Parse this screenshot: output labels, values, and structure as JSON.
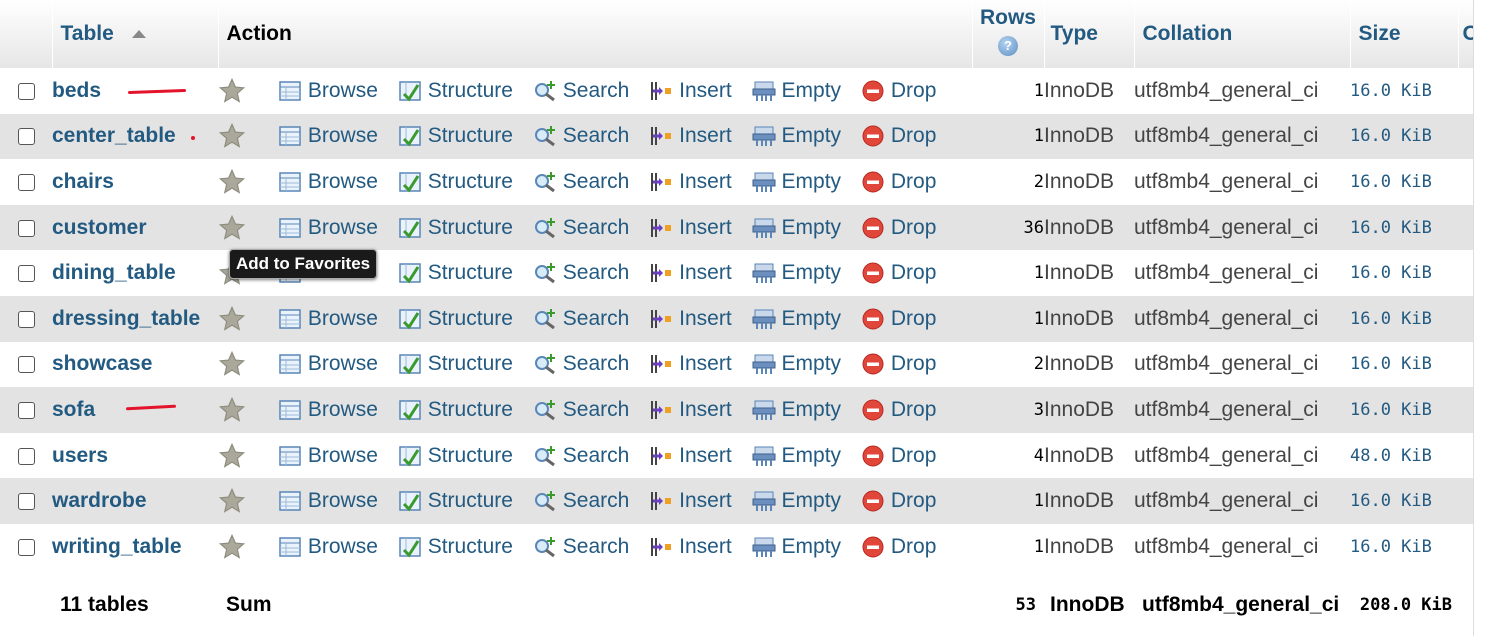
{
  "header": {
    "table": "Table",
    "action": "Action",
    "rows": "Rows",
    "type": "Type",
    "collation": "Collation",
    "size": "Size",
    "extra": "O"
  },
  "actions": {
    "browse": "Browse",
    "structure": "Structure",
    "search": "Search",
    "insert": "Insert",
    "empty": "Empty",
    "drop": "Drop"
  },
  "tables": [
    {
      "name": "beds",
      "rows": "1",
      "type": "InnoDB",
      "collation": "utf8mb4_general_ci",
      "size": "16.0 KiB"
    },
    {
      "name": "center_table",
      "rows": "1",
      "type": "InnoDB",
      "collation": "utf8mb4_general_ci",
      "size": "16.0 KiB"
    },
    {
      "name": "chairs",
      "rows": "2",
      "type": "InnoDB",
      "collation": "utf8mb4_general_ci",
      "size": "16.0 KiB"
    },
    {
      "name": "customer",
      "rows": "36",
      "type": "InnoDB",
      "collation": "utf8mb4_general_ci",
      "size": "16.0 KiB"
    },
    {
      "name": "dining_table",
      "rows": "1",
      "type": "InnoDB",
      "collation": "utf8mb4_general_ci",
      "size": "16.0 KiB"
    },
    {
      "name": "dressing_table",
      "rows": "1",
      "type": "InnoDB",
      "collation": "utf8mb4_general_ci",
      "size": "16.0 KiB"
    },
    {
      "name": "showcase",
      "rows": "2",
      "type": "InnoDB",
      "collation": "utf8mb4_general_ci",
      "size": "16.0 KiB"
    },
    {
      "name": "sofa",
      "rows": "3",
      "type": "InnoDB",
      "collation": "utf8mb4_general_ci",
      "size": "16.0 KiB"
    },
    {
      "name": "users",
      "rows": "4",
      "type": "InnoDB",
      "collation": "utf8mb4_general_ci",
      "size": "48.0 KiB"
    },
    {
      "name": "wardrobe",
      "rows": "1",
      "type": "InnoDB",
      "collation": "utf8mb4_general_ci",
      "size": "16.0 KiB"
    },
    {
      "name": "writing_table",
      "rows": "1",
      "type": "InnoDB",
      "collation": "utf8mb4_general_ci",
      "size": "16.0 KiB"
    }
  ],
  "footer": {
    "count": "11 tables",
    "sum": "Sum",
    "rows": "53",
    "type": "InnoDB",
    "collation": "utf8mb4_general_ci",
    "size": "208.0 KiB"
  },
  "tooltip": "Add to Favorites",
  "colors": {
    "link": "#235a81",
    "row_alt": "#e3e3e3",
    "annotation": "#e3132b"
  }
}
